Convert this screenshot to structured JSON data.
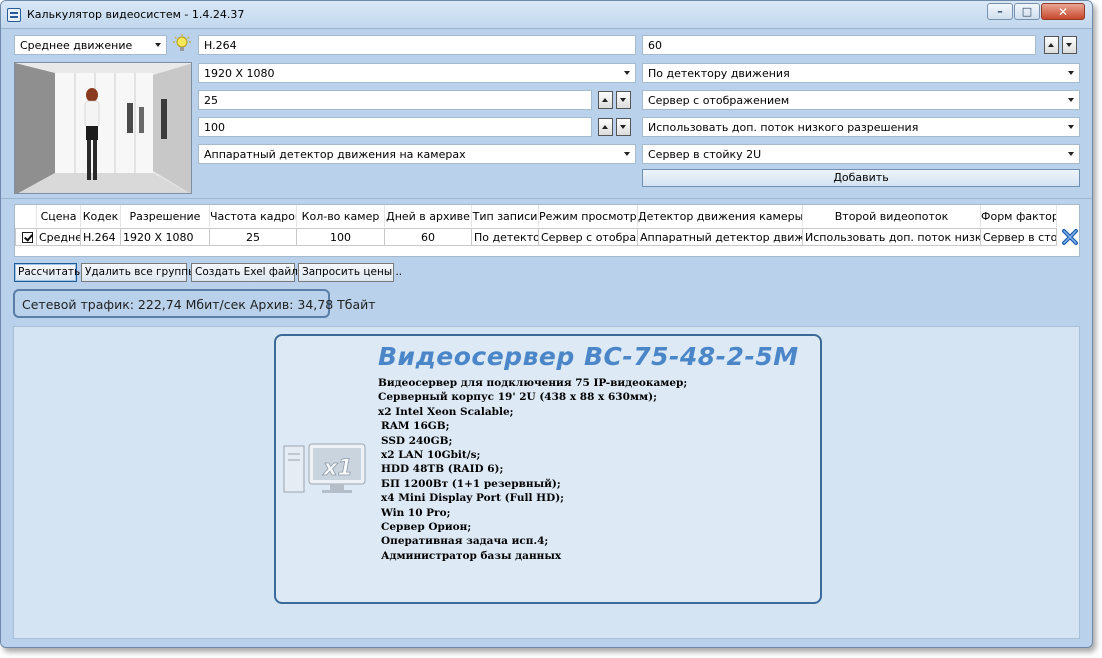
{
  "window": {
    "title": "Калькулятор видеосистем - 1.4.24.37",
    "controls": {
      "minimize": "–",
      "maximize": "□",
      "close": "✕"
    }
  },
  "form": {
    "scene": "Среднее движение",
    "codec": "H.264",
    "resolution": "1920 X 1080",
    "fps": "25",
    "camera_count": "100",
    "motion_detector": "Аппаратный детектор движения на камерах",
    "archive_days": "60",
    "record_type": "По детектору движения",
    "view_mode": "Сервер с отображением",
    "second_stream": "Использовать доп. поток низкого разрешения",
    "form_factor": "Сервер в стойку 2U",
    "add_label": "Добавить"
  },
  "grid": {
    "columns": [
      "Сцена",
      "Кодек",
      "Разрешение",
      "Частота кадров",
      "Кол-во камер",
      "Дней в архиве",
      "Тип записи",
      "Режим просмотра",
      "Детектор движения камеры",
      "Второй видеопоток",
      "Форм фактор"
    ],
    "rows": [
      {
        "scene": "Среднее движение",
        "codec": "H.264",
        "resolution": "1920 X 1080",
        "fps": "25",
        "cameras": "100",
        "days": "60",
        "record": "По детектору",
        "view": "Сервер с отображе",
        "detector": "Аппаратный детектор движения",
        "stream": "Использовать доп. поток низкого р",
        "form_factor": "Сервер в стойк"
      }
    ]
  },
  "toolbar": {
    "calculate": "Рассчитать",
    "delete_all": "Удалить все группы",
    "create_excel": "Создать Exel файл ..",
    "request_prices": "Запросить цены .."
  },
  "summary": "Сетевой трафик: 222,74 Мбит/сек   Архив: 34,78 Тбайт",
  "result": {
    "title": "Видеосервер ВС-75-48-2-5М",
    "specs": [
      "Видеосервер для подключения 75 IP-видеокамер;",
      "Серверный корпус 19' 2U (438 x 88 x 630мм);",
      "x2 Intel Xeon Scalable;",
      " RAM 16GB;",
      " SSD 240GB;",
      " x2 LAN 10Gbit/s;",
      " HDD 48TB (RAID 6);",
      " БП 1200Вт (1+1 резервный);",
      " x4 Mini Display Port (Full HD);",
      " Win 10 Pro;",
      " Сервер Орион;",
      " Оперативная задача исп.4;",
      " Администратор базы данных"
    ],
    "icon_text": "x1"
  },
  "colors": {
    "window_bg": "#b9d1ea",
    "panel_bg": "#d5e4f3",
    "accent_blue": "#4a86c8",
    "border_blue": "#3a6a9a"
  },
  "icons": [
    "app-icon",
    "bulb-icon",
    "preview-photo",
    "delete-row-icon",
    "server-icon"
  ]
}
